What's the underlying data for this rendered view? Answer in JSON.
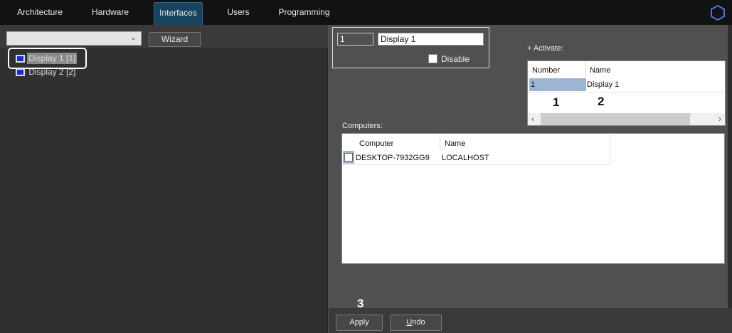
{
  "tabs": [
    "Architecture",
    "Hardware",
    "Interfaces",
    "Users",
    "Programming"
  ],
  "active_tab": "Interfaces",
  "wizard_label": "Wizard",
  "combo_value": "",
  "tree": [
    {
      "label": "Display 1 [1]",
      "selected": true
    },
    {
      "label": "Display 2 [2]",
      "selected": false
    }
  ],
  "display": {
    "number": "1",
    "name": "Display 1",
    "disable_label": "Disable",
    "disabled": false
  },
  "activate": {
    "label": "+ Activate:",
    "columns": [
      "Number",
      "Name"
    ],
    "rows": [
      [
        "1",
        "Display 1"
      ]
    ]
  },
  "computers": {
    "label": "Computers:",
    "columns": [
      "Computer",
      "Name"
    ],
    "rows": [
      {
        "checked": false,
        "computer": "DESKTOP-7932GG9",
        "name": "LOCALHOST"
      }
    ]
  },
  "annotations": [
    "1",
    "2",
    "3"
  ],
  "buttons": {
    "apply": "Apply",
    "undo_u": "U",
    "undo_rest": "ndo"
  },
  "colors": {
    "accent": "#17445f",
    "selection": "#9db5d1",
    "logo": "#4a78d0"
  }
}
